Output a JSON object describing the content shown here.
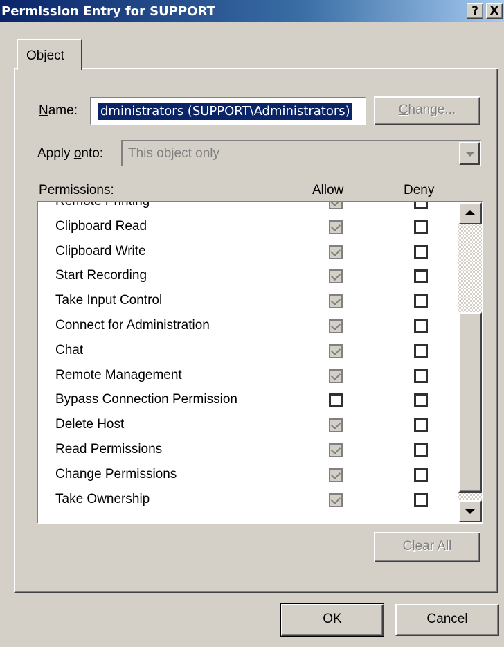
{
  "window": {
    "title": "Permission Entry for SUPPORT",
    "help_button": "?",
    "close_button": "X"
  },
  "tabs": [
    {
      "label": "Object",
      "active": true
    }
  ],
  "name_field": {
    "label": "Name:",
    "label_accel": "N",
    "label_rest": "ame:",
    "value": "dministrators (SUPPORT\\Administrators)"
  },
  "change_button": {
    "label": "Change...",
    "accel": "C",
    "rest": "hange...",
    "enabled": false
  },
  "apply_onto": {
    "label": "Apply onto:",
    "label_pre": "Apply ",
    "label_accel": "o",
    "label_post": "nto:",
    "value": "This object only",
    "enabled": false
  },
  "permissions": {
    "label": "Permissions:",
    "label_accel": "P",
    "label_rest": "ermissions:",
    "col_allow": "Allow",
    "col_deny": "Deny",
    "rows": [
      {
        "name": "Remote Printing",
        "allow": true,
        "deny": false
      },
      {
        "name": "Clipboard Read",
        "allow": true,
        "deny": false
      },
      {
        "name": "Clipboard Write",
        "allow": true,
        "deny": false
      },
      {
        "name": "Start Recording",
        "allow": true,
        "deny": false
      },
      {
        "name": "Take Input Control",
        "allow": true,
        "deny": false
      },
      {
        "name": "Connect for Administration",
        "allow": true,
        "deny": false
      },
      {
        "name": "Chat",
        "allow": true,
        "deny": false
      },
      {
        "name": "Remote Management",
        "allow": true,
        "deny": false
      },
      {
        "name": "Bypass Connection Permission",
        "allow": false,
        "deny": false
      },
      {
        "name": "Delete Host",
        "allow": true,
        "deny": false
      },
      {
        "name": "Read Permissions",
        "allow": true,
        "deny": false
      },
      {
        "name": "Change Permissions",
        "allow": true,
        "deny": false
      },
      {
        "name": "Take Ownership",
        "allow": true,
        "deny": false
      }
    ],
    "scroll_position": 0.92
  },
  "clear_all_button": {
    "label": "Clear All",
    "pre": "C",
    "accel": "l",
    "rest": "ear All",
    "enabled": false
  },
  "ok_button": {
    "label": "OK"
  },
  "cancel_button": {
    "label": "Cancel"
  }
}
